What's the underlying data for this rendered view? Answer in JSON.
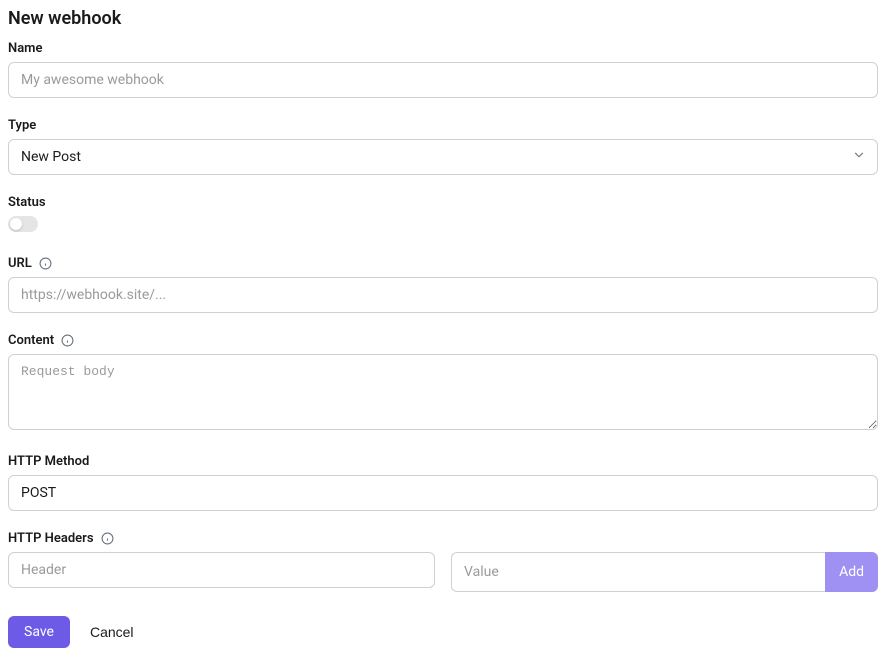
{
  "page": {
    "title": "New webhook"
  },
  "fields": {
    "name": {
      "label": "Name",
      "placeholder": "My awesome webhook",
      "value": ""
    },
    "type": {
      "label": "Type",
      "value": "New Post"
    },
    "status": {
      "label": "Status",
      "enabled": false
    },
    "url": {
      "label": "URL",
      "placeholder": "https://webhook.site/...",
      "value": ""
    },
    "content": {
      "label": "Content",
      "placeholder": "Request body",
      "value": ""
    },
    "http_method": {
      "label": "HTTP Method",
      "value": "POST"
    },
    "http_headers": {
      "label": "HTTP Headers",
      "header_placeholder": "Header",
      "value_placeholder": "Value",
      "add_label": "Add"
    }
  },
  "actions": {
    "save": "Save",
    "cancel": "Cancel"
  }
}
